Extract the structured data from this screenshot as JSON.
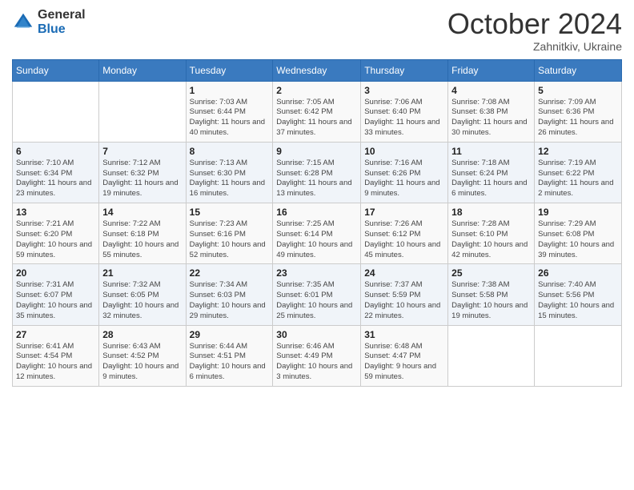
{
  "logo": {
    "general": "General",
    "blue": "Blue"
  },
  "header": {
    "month": "October 2024",
    "location": "Zahnitkiv, Ukraine"
  },
  "weekdays": [
    "Sunday",
    "Monday",
    "Tuesday",
    "Wednesday",
    "Thursday",
    "Friday",
    "Saturday"
  ],
  "weeks": [
    [
      {
        "day": "",
        "info": ""
      },
      {
        "day": "",
        "info": ""
      },
      {
        "day": "1",
        "info": "Sunrise: 7:03 AM\nSunset: 6:44 PM\nDaylight: 11 hours and 40 minutes."
      },
      {
        "day": "2",
        "info": "Sunrise: 7:05 AM\nSunset: 6:42 PM\nDaylight: 11 hours and 37 minutes."
      },
      {
        "day": "3",
        "info": "Sunrise: 7:06 AM\nSunset: 6:40 PM\nDaylight: 11 hours and 33 minutes."
      },
      {
        "day": "4",
        "info": "Sunrise: 7:08 AM\nSunset: 6:38 PM\nDaylight: 11 hours and 30 minutes."
      },
      {
        "day": "5",
        "info": "Sunrise: 7:09 AM\nSunset: 6:36 PM\nDaylight: 11 hours and 26 minutes."
      }
    ],
    [
      {
        "day": "6",
        "info": "Sunrise: 7:10 AM\nSunset: 6:34 PM\nDaylight: 11 hours and 23 minutes."
      },
      {
        "day": "7",
        "info": "Sunrise: 7:12 AM\nSunset: 6:32 PM\nDaylight: 11 hours and 19 minutes."
      },
      {
        "day": "8",
        "info": "Sunrise: 7:13 AM\nSunset: 6:30 PM\nDaylight: 11 hours and 16 minutes."
      },
      {
        "day": "9",
        "info": "Sunrise: 7:15 AM\nSunset: 6:28 PM\nDaylight: 11 hours and 13 minutes."
      },
      {
        "day": "10",
        "info": "Sunrise: 7:16 AM\nSunset: 6:26 PM\nDaylight: 11 hours and 9 minutes."
      },
      {
        "day": "11",
        "info": "Sunrise: 7:18 AM\nSunset: 6:24 PM\nDaylight: 11 hours and 6 minutes."
      },
      {
        "day": "12",
        "info": "Sunrise: 7:19 AM\nSunset: 6:22 PM\nDaylight: 11 hours and 2 minutes."
      }
    ],
    [
      {
        "day": "13",
        "info": "Sunrise: 7:21 AM\nSunset: 6:20 PM\nDaylight: 10 hours and 59 minutes."
      },
      {
        "day": "14",
        "info": "Sunrise: 7:22 AM\nSunset: 6:18 PM\nDaylight: 10 hours and 55 minutes."
      },
      {
        "day": "15",
        "info": "Sunrise: 7:23 AM\nSunset: 6:16 PM\nDaylight: 10 hours and 52 minutes."
      },
      {
        "day": "16",
        "info": "Sunrise: 7:25 AM\nSunset: 6:14 PM\nDaylight: 10 hours and 49 minutes."
      },
      {
        "day": "17",
        "info": "Sunrise: 7:26 AM\nSunset: 6:12 PM\nDaylight: 10 hours and 45 minutes."
      },
      {
        "day": "18",
        "info": "Sunrise: 7:28 AM\nSunset: 6:10 PM\nDaylight: 10 hours and 42 minutes."
      },
      {
        "day": "19",
        "info": "Sunrise: 7:29 AM\nSunset: 6:08 PM\nDaylight: 10 hours and 39 minutes."
      }
    ],
    [
      {
        "day": "20",
        "info": "Sunrise: 7:31 AM\nSunset: 6:07 PM\nDaylight: 10 hours and 35 minutes."
      },
      {
        "day": "21",
        "info": "Sunrise: 7:32 AM\nSunset: 6:05 PM\nDaylight: 10 hours and 32 minutes."
      },
      {
        "day": "22",
        "info": "Sunrise: 7:34 AM\nSunset: 6:03 PM\nDaylight: 10 hours and 29 minutes."
      },
      {
        "day": "23",
        "info": "Sunrise: 7:35 AM\nSunset: 6:01 PM\nDaylight: 10 hours and 25 minutes."
      },
      {
        "day": "24",
        "info": "Sunrise: 7:37 AM\nSunset: 5:59 PM\nDaylight: 10 hours and 22 minutes."
      },
      {
        "day": "25",
        "info": "Sunrise: 7:38 AM\nSunset: 5:58 PM\nDaylight: 10 hours and 19 minutes."
      },
      {
        "day": "26",
        "info": "Sunrise: 7:40 AM\nSunset: 5:56 PM\nDaylight: 10 hours and 15 minutes."
      }
    ],
    [
      {
        "day": "27",
        "info": "Sunrise: 6:41 AM\nSunset: 4:54 PM\nDaylight: 10 hours and 12 minutes."
      },
      {
        "day": "28",
        "info": "Sunrise: 6:43 AM\nSunset: 4:52 PM\nDaylight: 10 hours and 9 minutes."
      },
      {
        "day": "29",
        "info": "Sunrise: 6:44 AM\nSunset: 4:51 PM\nDaylight: 10 hours and 6 minutes."
      },
      {
        "day": "30",
        "info": "Sunrise: 6:46 AM\nSunset: 4:49 PM\nDaylight: 10 hours and 3 minutes."
      },
      {
        "day": "31",
        "info": "Sunrise: 6:48 AM\nSunset: 4:47 PM\nDaylight: 9 hours and 59 minutes."
      },
      {
        "day": "",
        "info": ""
      },
      {
        "day": "",
        "info": ""
      }
    ]
  ]
}
